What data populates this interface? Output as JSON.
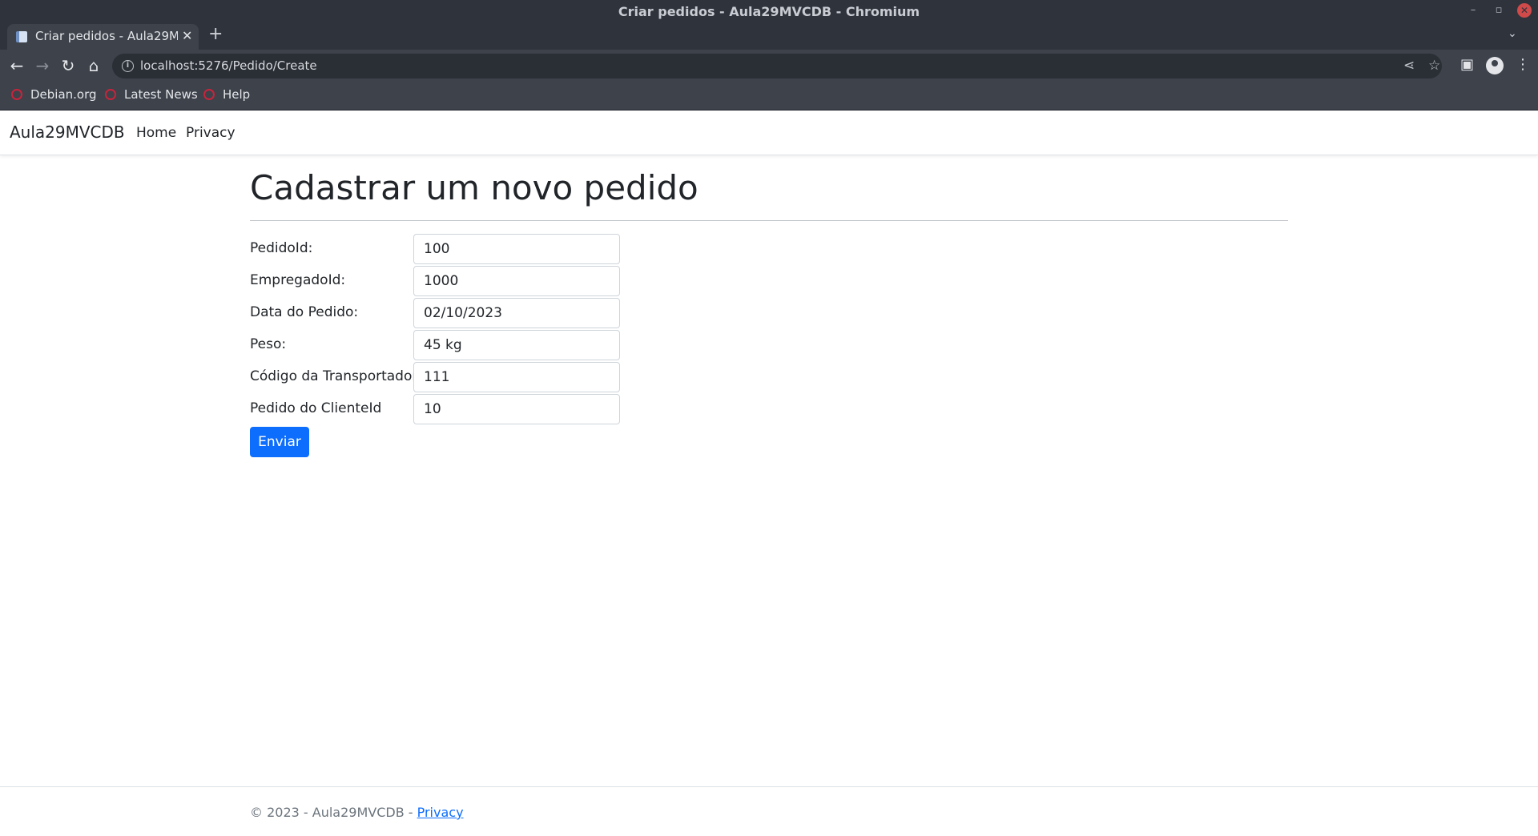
{
  "window": {
    "title": "Criar pedidos - Aula29MVCDB - Chromium"
  },
  "tab": {
    "title": "Criar pedidos - Aula29MVCDB"
  },
  "address_bar": {
    "url": "localhost:5276/Pedido/Create"
  },
  "bookmarks": [
    {
      "label": "Debian.org"
    },
    {
      "label": "Latest News"
    },
    {
      "label": "Help"
    }
  ],
  "site_nav": {
    "brand": "Aula29MVCDB",
    "links": [
      {
        "label": "Home"
      },
      {
        "label": "Privacy"
      }
    ]
  },
  "form": {
    "title": "Cadastrar um novo pedido",
    "fields": [
      {
        "label": "PedidoId:",
        "value": "100"
      },
      {
        "label": "EmpregadoId:",
        "value": "1000"
      },
      {
        "label": "Data do Pedido:",
        "value": "02/10/2023"
      },
      {
        "label": "Peso:",
        "value": "45 kg"
      },
      {
        "label": "Código da Transportadora:",
        "value": "111"
      },
      {
        "label": "Pedido do ClienteId",
        "value": "10"
      }
    ],
    "submit_label": "Enviar"
  },
  "footer": {
    "text": "© 2023 - Aula29MVCDB - ",
    "link": "Privacy"
  },
  "colors": {
    "chrome_dark": "#2f333c",
    "chrome_toolbar": "#3d424b",
    "primary": "#0d6efd",
    "text": "#212529"
  },
  "icons": [
    "page-icon",
    "close-icon",
    "plus-icon",
    "chevron-down-icon",
    "back-icon",
    "forward-icon",
    "reload-icon",
    "home-icon",
    "info-icon",
    "share-icon",
    "star-icon",
    "sidebar-icon",
    "profile-icon",
    "menu-icon",
    "minimize-icon",
    "restore-icon",
    "debian-icon"
  ]
}
